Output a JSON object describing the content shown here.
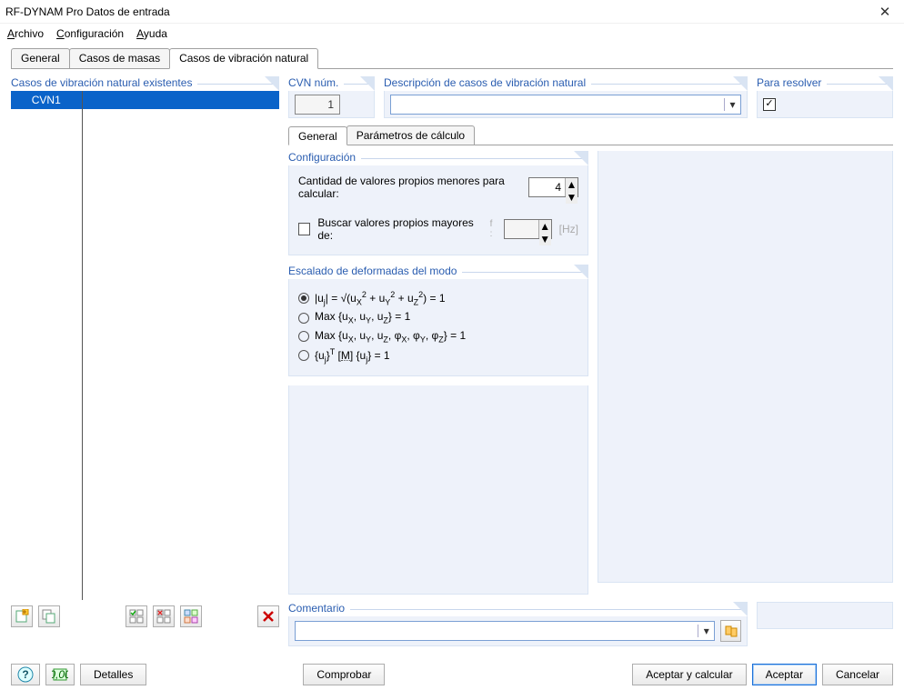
{
  "window": {
    "title": "RF-DYNAM Pro Datos de entrada",
    "close": "✕"
  },
  "menu": {
    "file": "Archivo",
    "config": "Configuración",
    "help": "Ayuda"
  },
  "mainTabs": {
    "general": "General",
    "mass": "Casos de masas",
    "nvc": "Casos de vibración natural"
  },
  "left": {
    "header": "Casos de vibración natural existentes",
    "items": [
      {
        "id": "CVN1",
        "desc": ""
      }
    ]
  },
  "fields": {
    "cvn": {
      "label": "CVN núm.",
      "value": "1"
    },
    "desc": {
      "label": "Descripción de casos de vibración natural",
      "value": ""
    },
    "solve": {
      "label": "Para resolver",
      "checked": true
    }
  },
  "subTabs": {
    "general": "General",
    "calc": "Parámetros de cálculo"
  },
  "config": {
    "header": "Configuración",
    "eigenLabel": "Cantidad de valores propios menores para calcular:",
    "eigenValue": "4",
    "searchGreater": {
      "checked": false,
      "label": "Buscar valores propios mayores de:",
      "fsuffix": "f :",
      "value": "",
      "unit": "[Hz]"
    }
  },
  "scaling": {
    "header": "Escalado de deformadas del modo",
    "opts": [
      "norm",
      "maxU",
      "maxAll",
      "mass"
    ],
    "selected": "norm"
  },
  "comment": {
    "header": "Comentario",
    "value": ""
  },
  "footer": {
    "details": "Detalles",
    "check": "Comprobar",
    "calcOk": "Aceptar y calcular",
    "ok": "Aceptar",
    "cancel": "Cancelar"
  }
}
